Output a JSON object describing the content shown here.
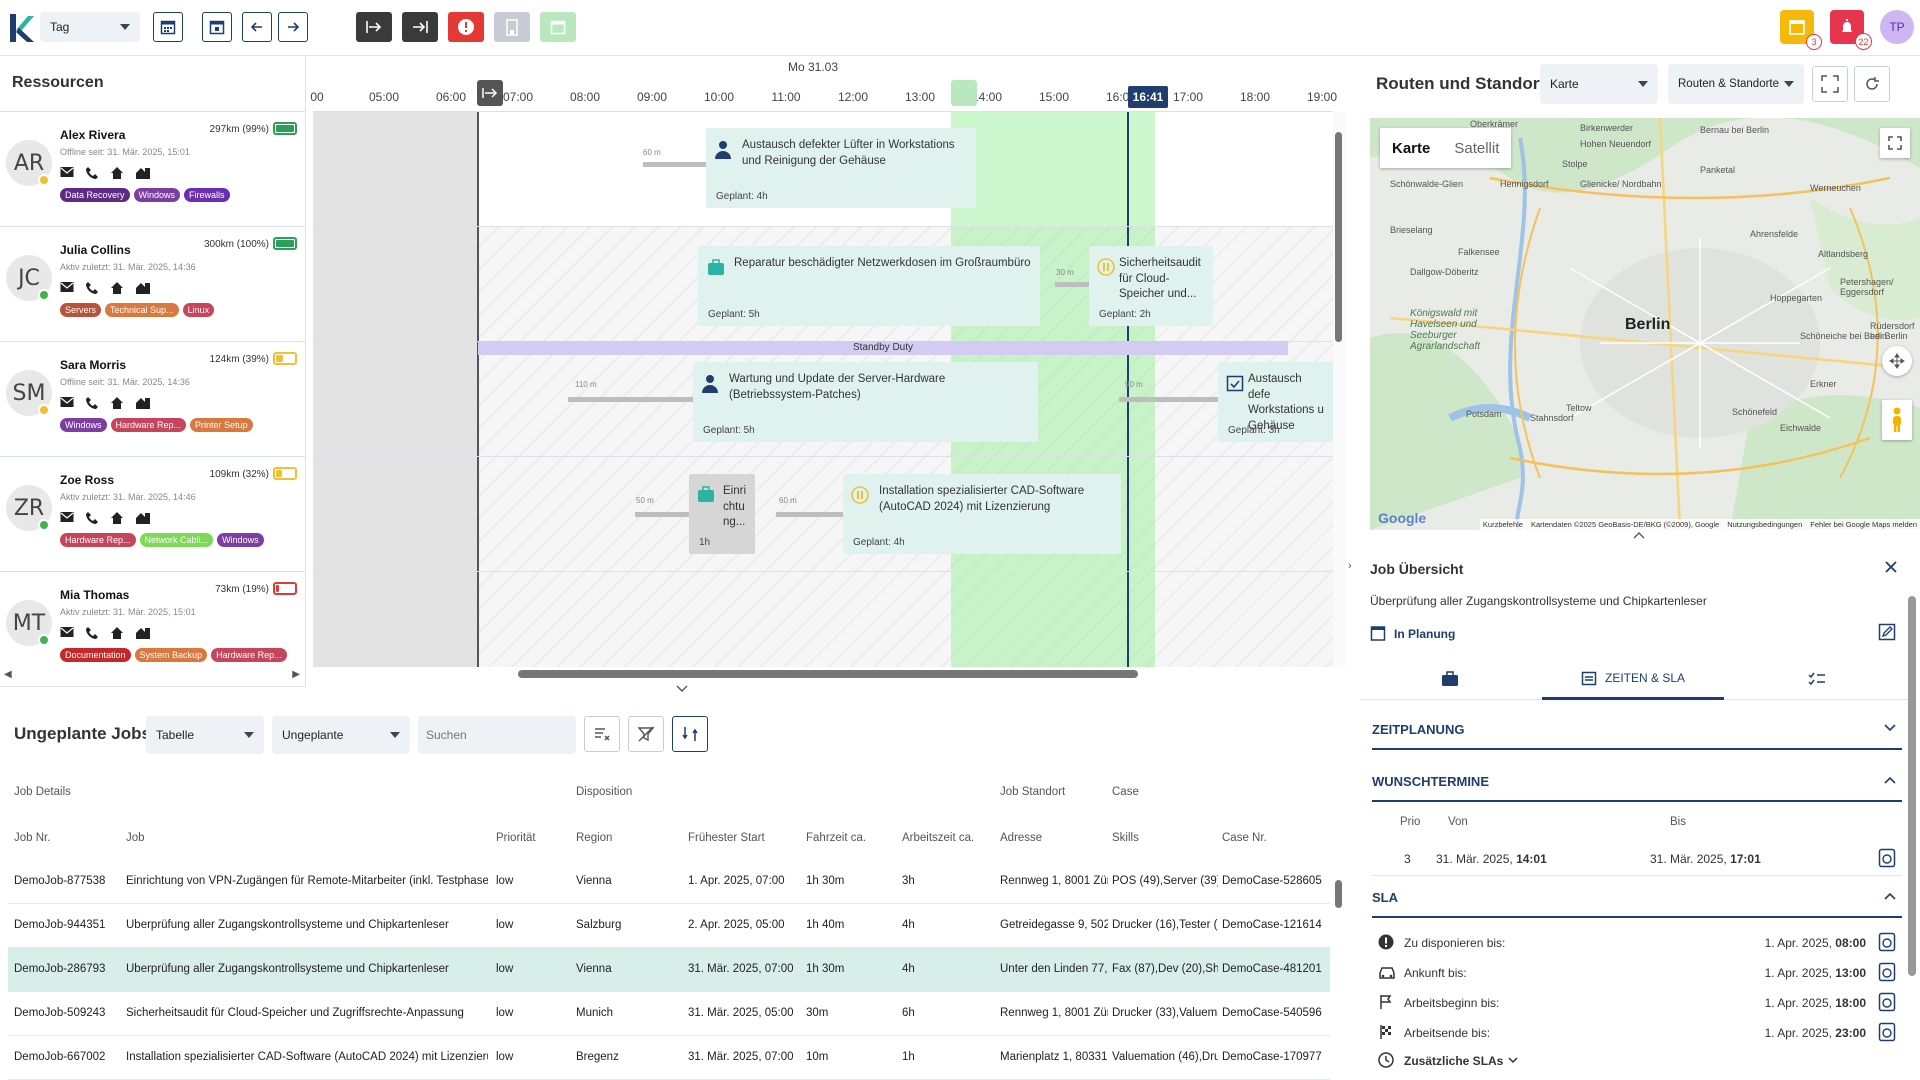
{
  "toolbar": {
    "view_select": "Tag",
    "notif_count": "3",
    "alert_count": "22",
    "user_initials": "TP"
  },
  "resources": {
    "title": "Ressourcen",
    "items": [
      {
        "initials": "AR",
        "name": "Alex Rivera",
        "status": "Offline seit: 31. Mär. 2025, 15:01",
        "km": "297km (99%)",
        "battery": 0.99,
        "battery_color": "#2e9e5b",
        "dot": "#f2c037",
        "tags": [
          {
            "label": "Data Recovery",
            "color": "#5e2a84"
          },
          {
            "label": "Windows",
            "color": "#7a3fa0"
          },
          {
            "label": "Firewalls",
            "color": "#6a2fb0"
          }
        ]
      },
      {
        "initials": "JC",
        "name": "Julia Collins",
        "status": "Aktiv zuletzt: 31. Mär. 2025, 14:36",
        "km": "300km (100%)",
        "battery": 1.0,
        "battery_color": "#2e9e5b",
        "dot": "#3cb54a",
        "tags": [
          {
            "label": "Servers",
            "color": "#b5533c"
          },
          {
            "label": "Technical Sup...",
            "color": "#d9783f"
          },
          {
            "label": "Linux",
            "color": "#c6455a"
          }
        ]
      },
      {
        "initials": "SM",
        "name": "Sara Morris",
        "status": "Offline seit: 31. Mär. 2025, 14:36",
        "km": "124km (39%)",
        "battery": 0.39,
        "battery_color": "#f2c037",
        "dot": "#f2c037",
        "tags": [
          {
            "label": "Windows",
            "color": "#7a3fa0"
          },
          {
            "label": "Hardware Rep...",
            "color": "#c6455a"
          },
          {
            "label": "Printer Setup",
            "color": "#d9783f"
          }
        ]
      },
      {
        "initials": "ZR",
        "name": "Zoe Ross",
        "status": "Aktiv zuletzt: 31. Mär. 2025, 14:46",
        "km": "109km (32%)",
        "battery": 0.32,
        "battery_color": "#f2c037",
        "dot": "#3cb54a",
        "tags": [
          {
            "label": "Hardware Rep...",
            "color": "#c6455a"
          },
          {
            "label": "Network Cabli...",
            "color": "#7ed957"
          },
          {
            "label": "Windows",
            "color": "#7a3fa0"
          }
        ]
      },
      {
        "initials": "MT",
        "name": "Mia Thomas",
        "status": "Aktiv zuletzt: 31. Mär. 2025, 15:01",
        "km": "73km (19%)",
        "battery": 0.19,
        "battery_color": "#e53935",
        "dot": "#3cb54a",
        "tags": [
          {
            "label": "Documentation",
            "color": "#c62828"
          },
          {
            "label": "System Backup",
            "color": "#d9783f"
          },
          {
            "label": "Hardware Rep...",
            "color": "#c6455a"
          }
        ]
      }
    ]
  },
  "timeline": {
    "date": "Mo 31.03",
    "hours": [
      "00",
      "05:00",
      "06:00",
      "07:00",
      "08:00",
      "09:00",
      "10:00",
      "11:00",
      "12:00",
      "13:00",
      "14:00",
      "15:00",
      "16:00",
      "17:00",
      "18:00",
      "19:00"
    ],
    "now": "16:41",
    "standby": "Standby Duty",
    "jobs": [
      {
        "title": "Austausch defekter Lüfter in Workstations und Reinigung der Gehäuse",
        "plan": "Geplant: 4h",
        "travel": "60 m"
      },
      {
        "title": "Reparatur beschädigter Netzwerkdosen im Großraumbüro",
        "plan": "Geplant: 5h"
      },
      {
        "title": "Sicherheitsaudit für Cloud-Speicher und...",
        "plan": "Geplant: 2h",
        "travel": "30 m"
      },
      {
        "title": "Wartung und Update der Server-Hardware (Betriebssystem-Patches)",
        "plan": "Geplant: 5h",
        "travel": "110 m"
      },
      {
        "title": "Austausch defe Workstations u Gehäuse",
        "plan": "Geplant: 3h",
        "travel": "90 m"
      },
      {
        "title": "Einri chtu ng...",
        "plan": "1h",
        "travel": "50 m"
      },
      {
        "title": "Installation spezialisierter CAD-Software (AutoCAD 2024) mit Lizenzierung",
        "plan": "Geplant: 4h",
        "travel": "60 m"
      }
    ]
  },
  "unplanned": {
    "title": "Ungeplante Jobs",
    "view_select": "Tabelle",
    "filter_select": "Ungeplante",
    "search_placeholder": "Suchen",
    "groups": [
      "Job Details",
      "Disposition",
      "Job Standort",
      "Case"
    ],
    "columns": [
      "Job Nr.",
      "Job",
      "Priorität",
      "Region",
      "Frühester Start",
      "Fahrzeit ca.",
      "Arbeitszeit ca.",
      "Adresse",
      "Skills",
      "Case Nr."
    ],
    "rows": [
      [
        "DemoJob-877538",
        "Einrichtung von VPN-Zugängen für Remote-Mitarbeiter (inkl. Testphase)",
        "low",
        "Vienna",
        "1. Apr. 2025, 07:00",
        "1h 30m",
        "3h",
        "Rennweg 1, 8001 Züri",
        "POS (49),Server (39),\\",
        "DemoCase-528605"
      ],
      [
        "DemoJob-944351",
        "Überprüfung aller Zugangskontrollsysteme und Chipkartenleser",
        "low",
        "Salzburg",
        "2. Apr. 2025, 05:00",
        "1h 40m",
        "4h",
        "Getreidegasse 9, 502(",
        "Drucker (16),Tester (3",
        "DemoCase-121614"
      ],
      [
        "DemoJob-286793",
        "Überprüfung aller Zugangskontrollsysteme und Chipkartenleser",
        "low",
        "Vienna",
        "31. Mär. 2025, 07:00",
        "1h 30m",
        "4h",
        "Unter den Linden 77, ·",
        "Fax (87),Dev (20),Sho",
        "DemoCase-481201"
      ],
      [
        "DemoJob-509243",
        "Sicherheitsaudit für Cloud-Speicher und Zugriffsrechte-Anpassung",
        "low",
        "Munich",
        "31. Mär. 2025, 05:00",
        "30m",
        "6h",
        "Rennweg 1, 8001 Züri",
        "Drucker (33),Valuema",
        "DemoCase-540596"
      ],
      [
        "DemoJob-667002",
        "Installation spezialisierter CAD-Software (AutoCAD 2024) mit Lizenzierung",
        "low",
        "Bregenz",
        "31. Mär. 2025, 07:00",
        "10m",
        "1h",
        "Marienplatz 1, 80331",
        "Valuemation (46),Dru",
        "DemoCase-170977"
      ]
    ]
  },
  "map": {
    "title": "Routen und Standorte",
    "type_select": "Karte",
    "layer_select": "Routen & Standorte",
    "tab_map": "Karte",
    "tab_sat": "Satellit",
    "city": "Berlin",
    "places": [
      "Oberkrämer",
      "Birkenwerder",
      "Bernau bei Berlin",
      "Hohen Neuendorf",
      "Stolpe",
      "Panketal",
      "Schönwalde-Glien",
      "Hennigsdorf",
      "Glienicke/ Nordbahn",
      "Werneuchen",
      "Brieselang",
      "Falkensee",
      "Ahrensfelde",
      "Altlandsberg",
      "Dallgow-Döberitz",
      "Hoppegarten",
      "Petershagen/ Eggersdorf",
      "Königswald mit Havelseen und Seeburger Agrarlandschaft",
      "Schöneiche bei Berlin",
      "Rüdersdorf bei Berlin",
      "Erkner",
      "Teltow",
      "Potsdam",
      "Stahnsdorf",
      "Schönefeld",
      "Eichwalde"
    ],
    "attrib": [
      "Kurzbefehle",
      "Kartendaten ©2025 GeoBasis-DE/BKG (©2009), Google",
      "Nutzungsbedingungen",
      "Fehler bei Google Maps melden"
    ],
    "google": "Google"
  },
  "job_overview": {
    "title": "Job Übersicht",
    "desc": "Überprüfung aller Zugangskontrollsysteme und Chipkartenleser",
    "status": "In Planung",
    "tab_time": "ZEITEN & SLA",
    "zeitplanung": "ZEITPLANUNG",
    "wunsch": "WUNSCHTERMINE",
    "w_cols": [
      "Prio",
      "Von",
      "Bis"
    ],
    "w_row": {
      "prio": "3",
      "von_d": "31. Mär. 2025, ",
      "von_t": "14:01",
      "bis_d": "31. Mär. 2025, ",
      "bis_t": "17:01"
    },
    "sla": "SLA",
    "sla_rows": [
      {
        "label": "Zu disponieren bis:",
        "date": "1. Apr. 2025, ",
        "time": "08:00"
      },
      {
        "label": "Ankunft bis:",
        "date": "1. Apr. 2025, ",
        "time": "13:00"
      },
      {
        "label": "Arbeitsbeginn bis:",
        "date": "1. Apr. 2025, ",
        "time": "18:00"
      },
      {
        "label": "Arbeitsende bis:",
        "date": "1. Apr. 2025, ",
        "time": "23:00"
      }
    ],
    "extra_sla": "Zusätzliche SLAs"
  }
}
